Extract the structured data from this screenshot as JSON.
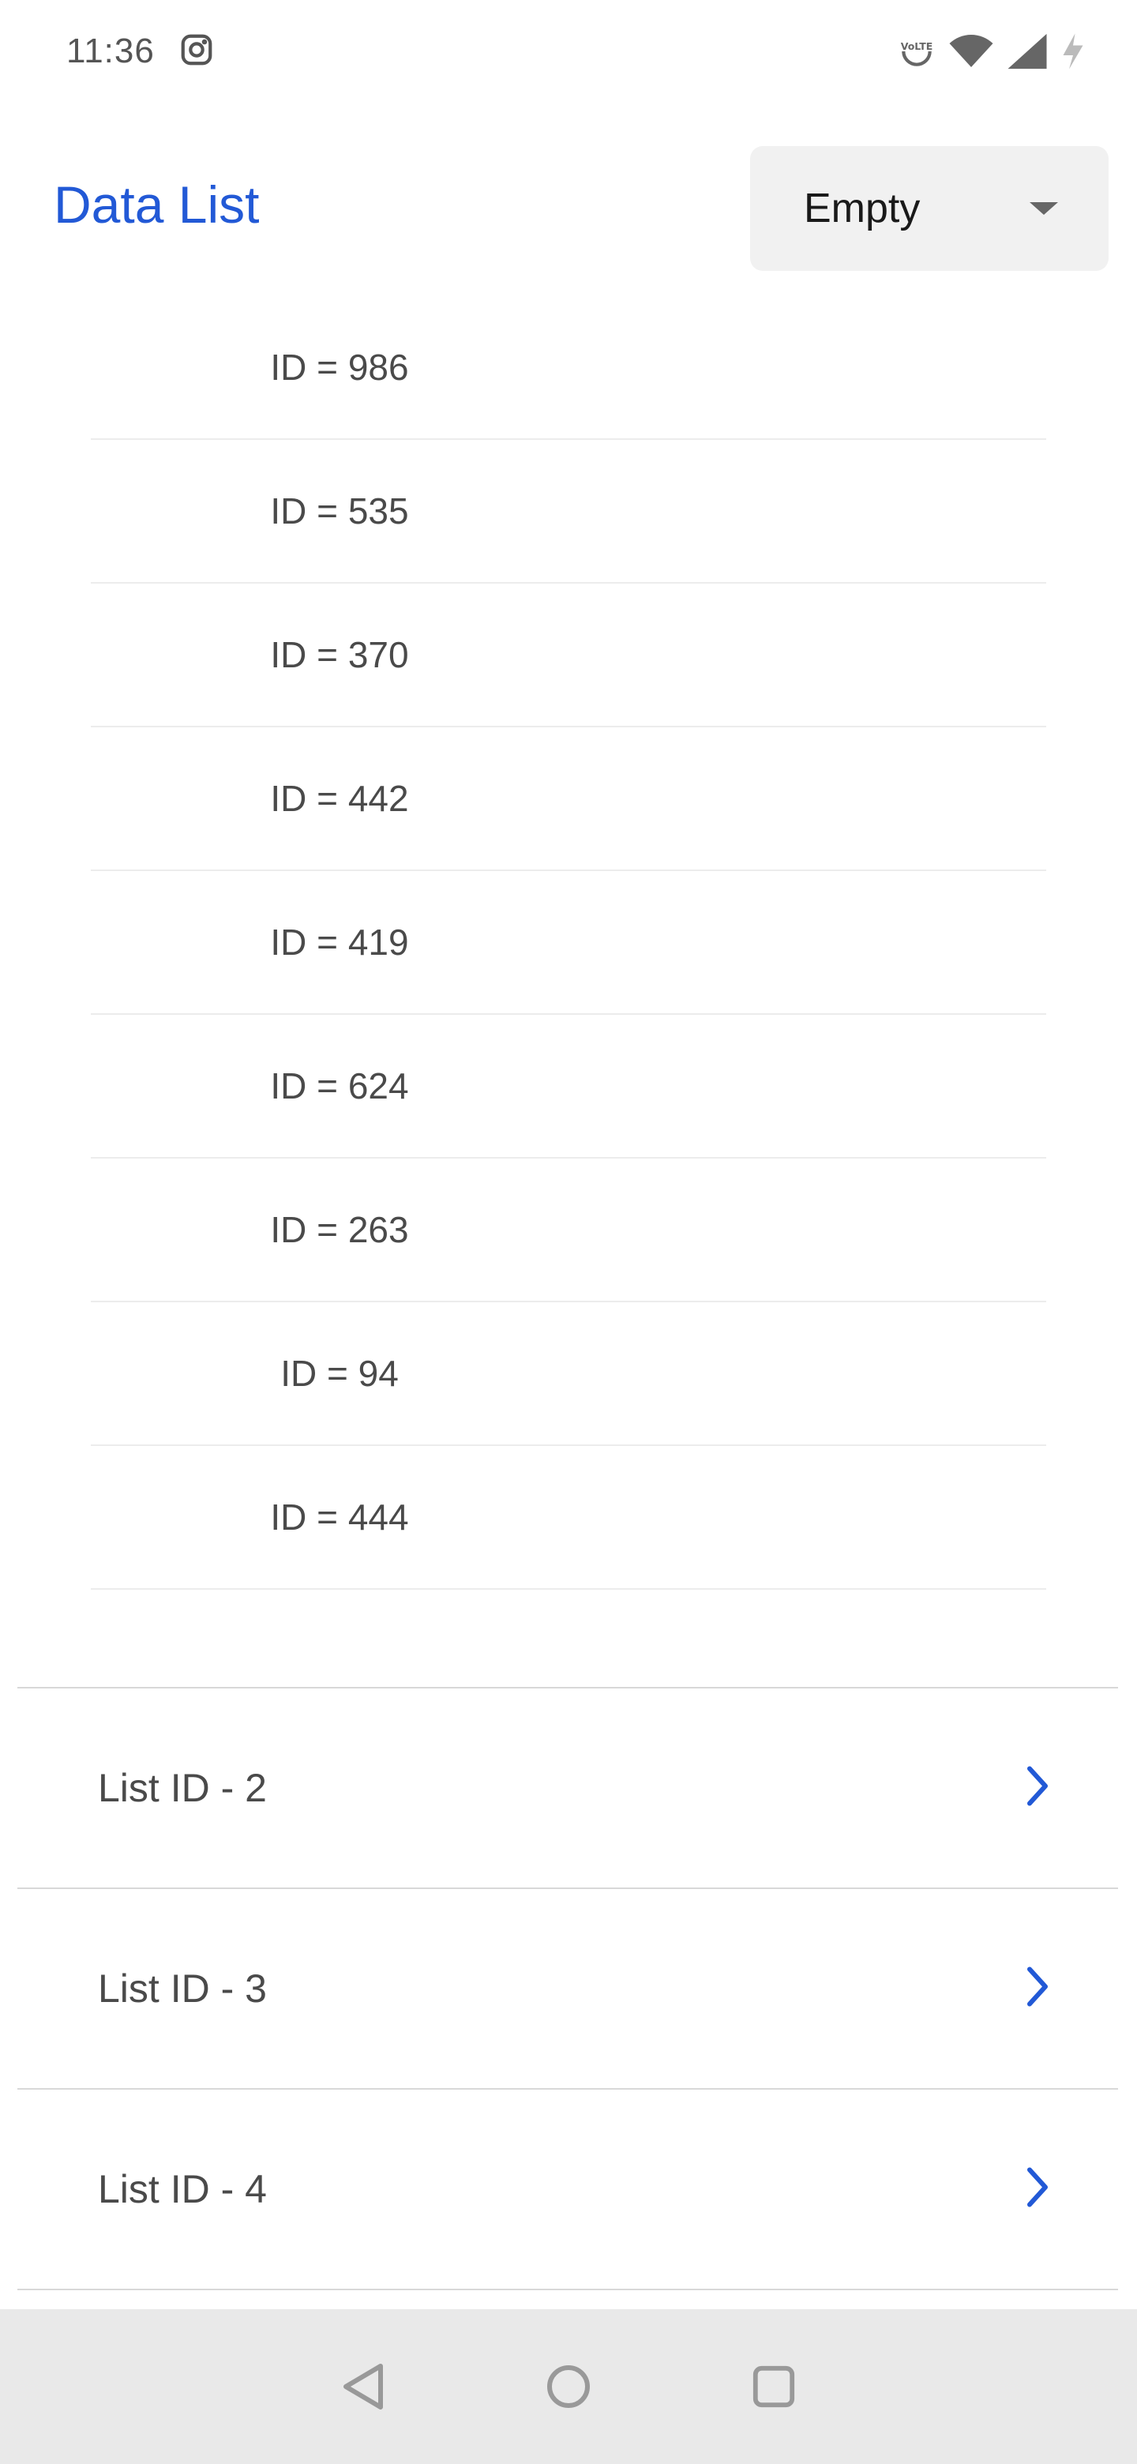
{
  "status_bar": {
    "time": "11:36",
    "icons": [
      "instagram-icon",
      "volte-icon",
      "wifi-icon",
      "signal-icon",
      "charging-icon"
    ]
  },
  "header": {
    "title": "Data List",
    "dropdown_value": "Empty"
  },
  "id_list": [
    {
      "label": "ID = 986"
    },
    {
      "label": "ID = 535"
    },
    {
      "label": "ID = 370"
    },
    {
      "label": "ID = 442"
    },
    {
      "label": "ID = 419"
    },
    {
      "label": "ID = 624"
    },
    {
      "label": "ID = 263"
    },
    {
      "label": "ID = 94"
    },
    {
      "label": "ID = 444"
    }
  ],
  "lists": [
    {
      "label": "List ID - 2"
    },
    {
      "label": "List ID - 3"
    },
    {
      "label": "List ID - 4"
    }
  ],
  "colors": {
    "accent": "#2259d6",
    "text": "#4a4a4a",
    "nav_bg": "#e9e9e9"
  },
  "nav": [
    "back-icon",
    "home-icon",
    "recents-icon"
  ]
}
